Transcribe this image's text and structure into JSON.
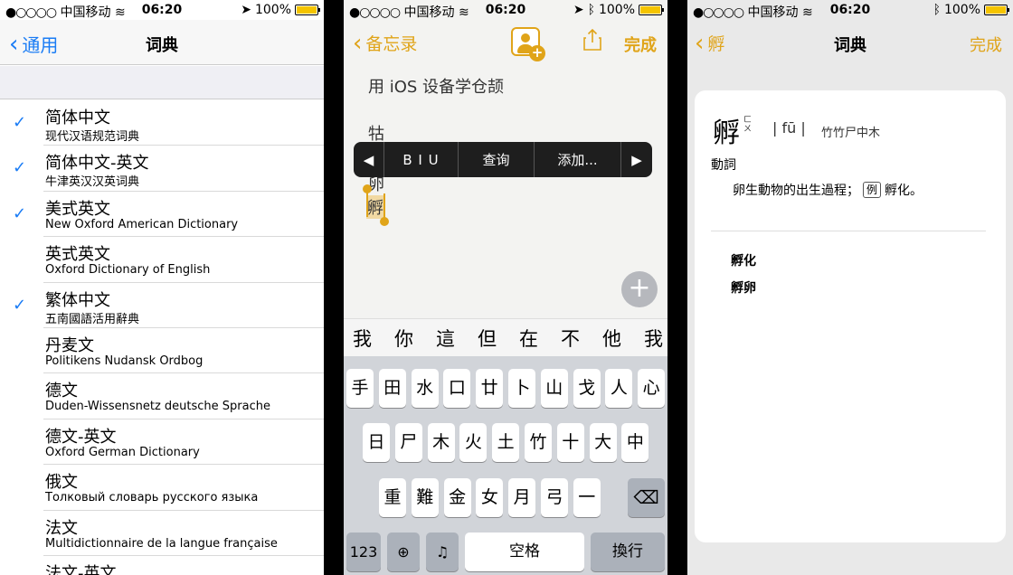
{
  "status_bar": {
    "signal": "●○○○○",
    "carrier": "中国移动",
    "time": "06:20",
    "battery": "100%",
    "battery_level": 1.0,
    "battery_color": "#f5c400"
  },
  "panel1": {
    "back_label": "通用",
    "title": "词典",
    "accent": "#1a7cf5",
    "dictionaries": [
      {
        "lang": "简体中文",
        "source": "现代汉语规范词典",
        "checked": true
      },
      {
        "lang": "简体中文-英文",
        "source": "牛津英汉汉英词典",
        "checked": true
      },
      {
        "lang": "美式英文",
        "source": "New Oxford American Dictionary",
        "checked": true
      },
      {
        "lang": "英式英文",
        "source": "Oxford Dictionary of English",
        "checked": false
      },
      {
        "lang": "繁体中文",
        "source": "五南國語活用辭典",
        "checked": true
      },
      {
        "lang": "丹麦文",
        "source": "Politikens Nudansk Ordbog",
        "checked": false
      },
      {
        "lang": "德文",
        "source": "Duden-Wissensnetz deutsche Sprache",
        "checked": false
      },
      {
        "lang": "德文-英文",
        "source": "Oxford German Dictionary",
        "checked": false
      },
      {
        "lang": "俄文",
        "source": "Толковый словарь русского языка",
        "checked": false
      },
      {
        "lang": "法文",
        "source": "Multidictionnaire de la langue française",
        "checked": false
      },
      {
        "lang": "法文-英文",
        "source": "",
        "checked": false
      }
    ]
  },
  "panel2": {
    "back_label": "备忘录",
    "done_label": "完成",
    "accent": "#e0a419",
    "note_line1": "用 iOS 设备学仓颉",
    "note_line2": "牯",
    "note_line3": "卵",
    "selected_text": "孵",
    "menu": {
      "left_arrow": "◀",
      "biu": "B I U",
      "lookup": "查询",
      "add": "添加...",
      "right_arrow": "▶"
    },
    "plus_label": "+",
    "candidates": [
      "我",
      "你",
      "這",
      "但",
      "在",
      "不",
      "他",
      "我"
    ],
    "keyboard": {
      "row1": [
        "手",
        "田",
        "水",
        "口",
        "廿",
        "卜",
        "山",
        "戈",
        "人",
        "心"
      ],
      "row2": [
        "日",
        "尸",
        "木",
        "火",
        "土",
        "竹",
        "十",
        "大",
        "中"
      ],
      "row3": [
        "重",
        "難",
        "金",
        "女",
        "月",
        "弓",
        "一"
      ],
      "delete": "⌫",
      "numbers": "123",
      "globe": "🌐",
      "mic": "🎤",
      "space": "空格",
      "return": "換行"
    }
  },
  "panel3": {
    "back_label": "孵",
    "title": "词典",
    "done_label": "完成",
    "entry": {
      "char": "孵",
      "bopomofo": "ㄈㄨ",
      "pinyin": "| fū |",
      "cangjie": "竹竹尸中木",
      "pos": "動詞",
      "definition": "卵生動物的出生過程；",
      "example_tag": "例",
      "example": "孵化。"
    },
    "related": [
      "孵化",
      "孵卵"
    ]
  }
}
